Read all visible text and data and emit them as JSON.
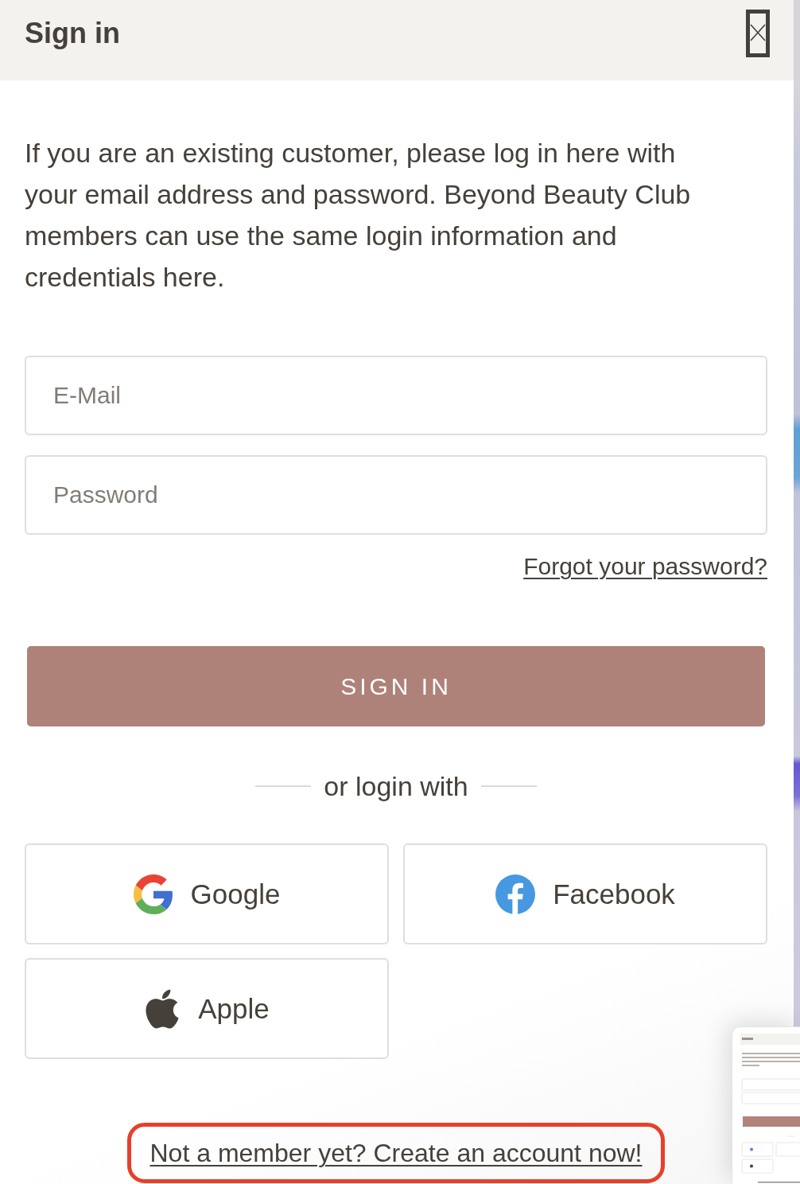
{
  "dialog": {
    "title": "Sign in",
    "intro": "If you are an existing customer, please log in here with your email address and password. Beyond Beauty Club members can use the same login information and credentials here."
  },
  "fields": [
    {
      "placeholder": "E-Mail"
    },
    {
      "placeholder": "Password"
    }
  ],
  "forgot_link": "Forgot your password?",
  "submit_button": "SIGN IN",
  "divider_text": "or login with",
  "social_buttons": [
    {
      "kind": "google",
      "label": "Google"
    },
    {
      "kind": "facebook",
      "label": "Facebook"
    },
    {
      "kind": "apple",
      "label": "Apple"
    }
  ],
  "signup_link": {
    "text": "Not a member yet? Create an account now!",
    "highlighted": true
  }
}
